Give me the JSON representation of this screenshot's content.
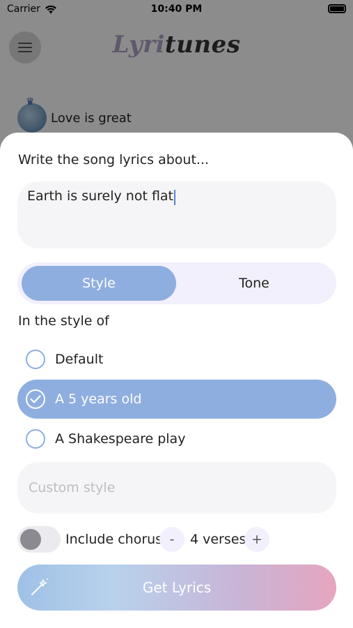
{
  "status_bar": {
    "carrier": "Carrier",
    "time": "10:40 PM"
  },
  "header": {
    "logo_part1": "Lyri",
    "logo_part2": "tunes",
    "menu_icon": "hamburger-icon"
  },
  "history": {
    "item_label": "Love is great"
  },
  "sheet": {
    "prompt_label": "Write the song lyrics about...",
    "topic_value": "Earth is surely not flat",
    "segments": {
      "style": "Style",
      "tone": "Tone",
      "selected": "Style"
    },
    "style_title": "In the style of",
    "options": [
      {
        "label": "Default",
        "selected": false
      },
      {
        "label": "A 5 years old",
        "selected": true
      },
      {
        "label": "A Shakespeare play",
        "selected": false
      }
    ],
    "custom_placeholder": "Custom style",
    "chorus_label": "Include chorus",
    "chorus_on": false,
    "minus_label": "-",
    "plus_label": "+",
    "verses_label": "4 verses",
    "get_button_label": "Get Lyrics"
  },
  "colors": {
    "accent": "#8faee0",
    "segment_bg": "#f2f0fd",
    "input_bg": "#f5f5f7"
  }
}
